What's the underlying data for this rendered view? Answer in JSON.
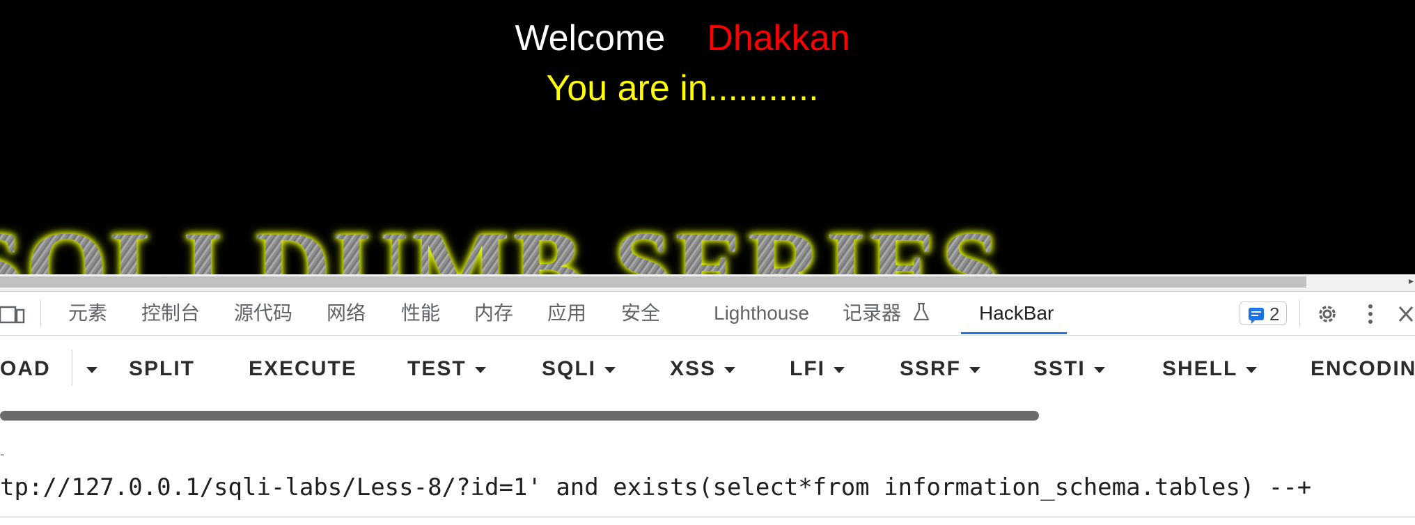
{
  "page": {
    "welcome_word": "Welcome",
    "welcome_user": "Dhakkan",
    "status_text": "You are in...........",
    "banner_text": "SQLI DUMB SERIES",
    "colors": {
      "background": "#000000",
      "welcome": "#ffffff",
      "user": "#ff0000",
      "status": "#ffff00"
    }
  },
  "devtools": {
    "tabs": [
      {
        "label": "元素"
      },
      {
        "label": "控制台"
      },
      {
        "label": "源代码"
      },
      {
        "label": "网络"
      },
      {
        "label": "性能"
      },
      {
        "label": "内存"
      },
      {
        "label": "应用"
      },
      {
        "label": "安全"
      },
      {
        "label": "Lighthouse"
      },
      {
        "label": "记录器"
      },
      {
        "label": "HackBar"
      }
    ],
    "active_tab": "HackBar",
    "issues_count": "2",
    "accent_color": "#1a73e8"
  },
  "hackbar": {
    "buttons": [
      {
        "label": "OAD",
        "has_menu": false
      },
      {
        "label": "SPLIT",
        "has_menu": false
      },
      {
        "label": "EXECUTE",
        "has_menu": false
      },
      {
        "label": "TEST",
        "has_menu": true
      },
      {
        "label": "SQLI",
        "has_menu": true
      },
      {
        "label": "XSS",
        "has_menu": true
      },
      {
        "label": "LFI",
        "has_menu": true
      },
      {
        "label": "SSRF",
        "has_menu": true
      },
      {
        "label": "SSTI",
        "has_menu": true
      },
      {
        "label": "SHELL",
        "has_menu": true
      },
      {
        "label": "ENCODIN",
        "has_menu": false
      }
    ],
    "url_value": "tp://127.0.0.1/sqli-labs/Less-8/?id=1' and exists(select*from information_schema.tables) --+"
  }
}
